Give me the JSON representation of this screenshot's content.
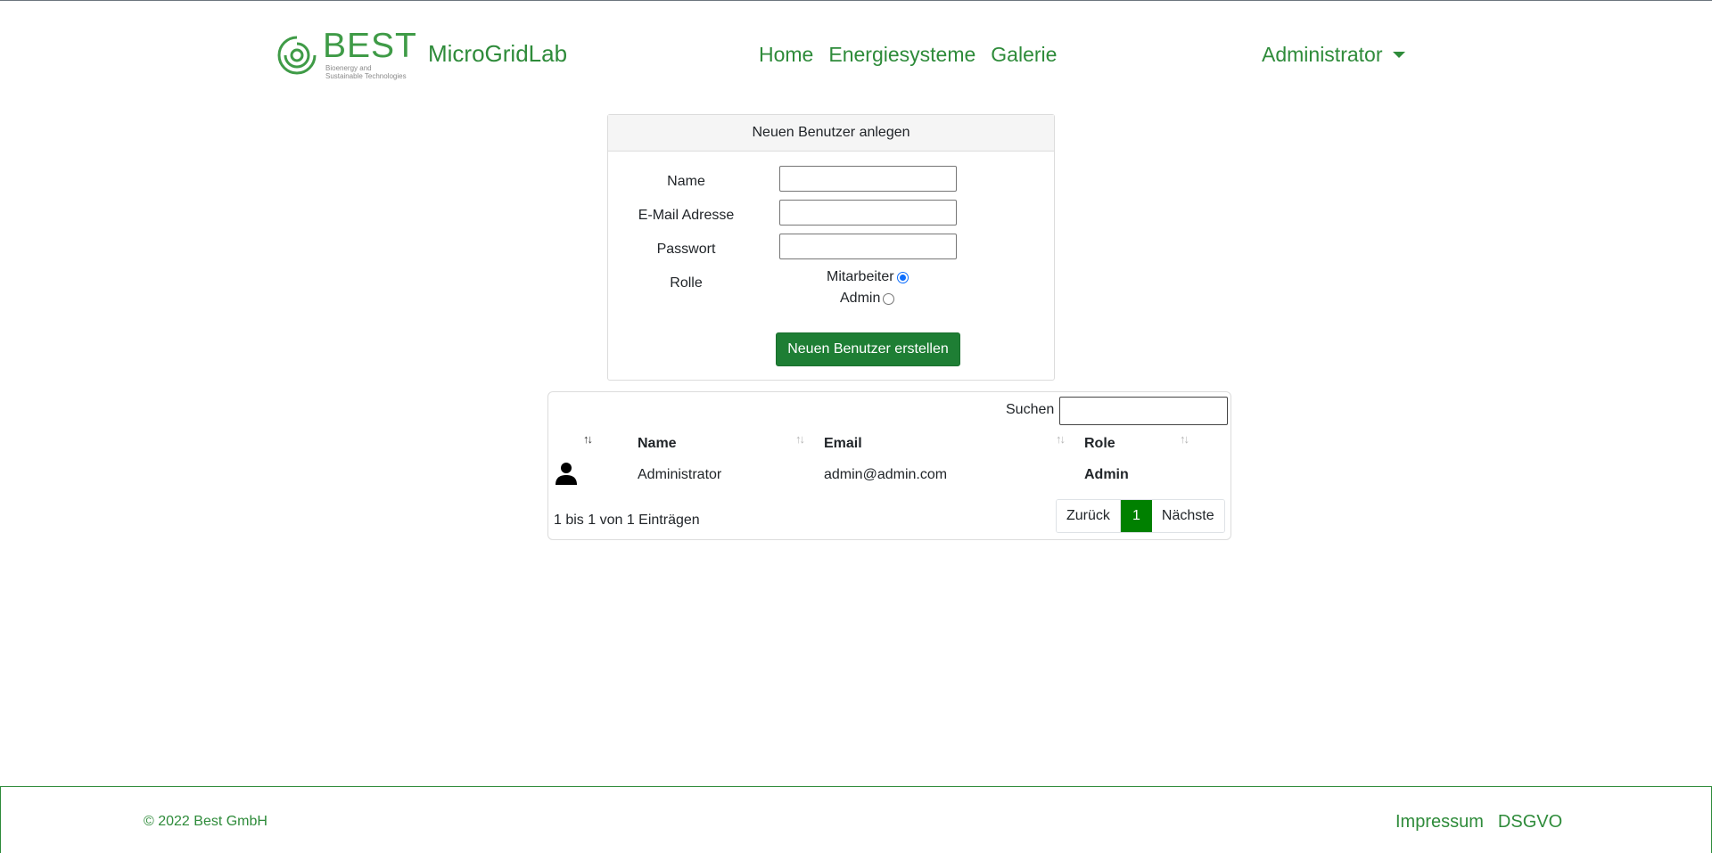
{
  "header": {
    "logo_word": "BEST",
    "logo_line1": "Bioenergy and",
    "logo_line2": "Sustainable Technologies",
    "brand": "MicroGridLab",
    "nav": [
      "Home",
      "Energiesysteme",
      "Galerie"
    ],
    "user_menu": "Administrator"
  },
  "form": {
    "title": "Neuen Benutzer anlegen",
    "name_label": "Name",
    "email_label": "E-Mail Adresse",
    "password_label": "Passwort",
    "role_label": "Rolle",
    "role_options": [
      "Mitarbeiter",
      "Admin"
    ],
    "role_selected": "Mitarbeiter",
    "submit": "Neuen Benutzer erstellen"
  },
  "table": {
    "search_label": "Suchen",
    "columns": [
      "Name",
      "Email",
      "Role"
    ],
    "rows": [
      {
        "name": "Administrator",
        "email": "admin@admin.com",
        "role": "Admin"
      }
    ],
    "info": "1 bis 1 von 1 Einträgen",
    "pager": {
      "prev": "Zurück",
      "page": "1",
      "next": "Nächste"
    }
  },
  "footer": {
    "copyright": "© 2022 Best GmbH",
    "links": [
      "Impressum",
      "DSGVO"
    ]
  },
  "colors": {
    "brand_green": "#2e8b3a",
    "button_green": "#1e7e34",
    "active_page": "#008000"
  }
}
